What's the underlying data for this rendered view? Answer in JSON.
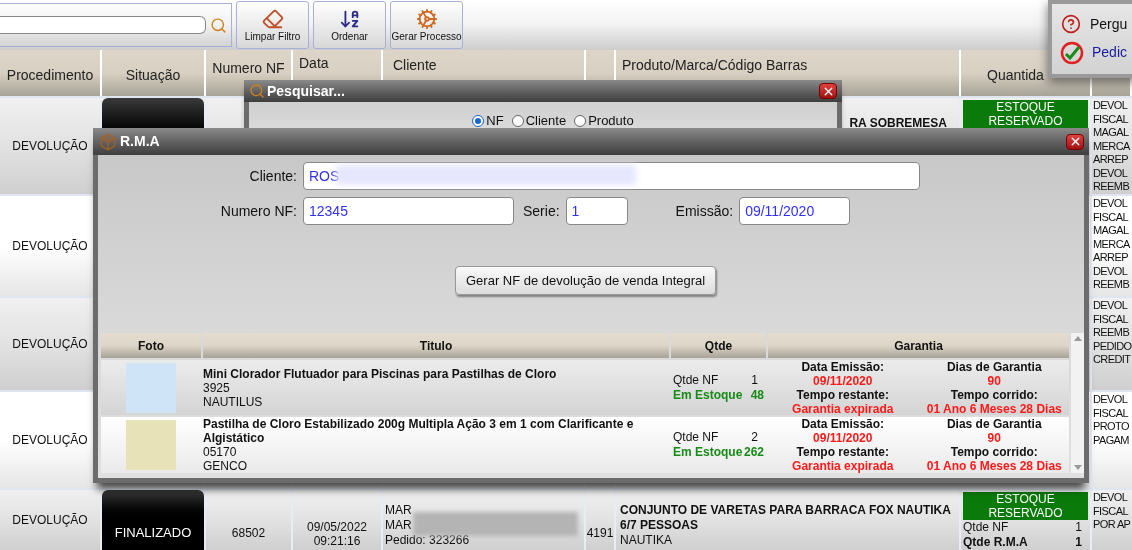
{
  "toolbar": {
    "buttons": [
      {
        "label": "Limpar Filtro",
        "kind": "eraser"
      },
      {
        "label": "Ordenar",
        "kind": "sort"
      },
      {
        "label": "Gerar Processo",
        "kind": "process"
      }
    ]
  },
  "menu": {
    "items": [
      {
        "label": "Pergu",
        "kind": "question"
      },
      {
        "label": "Pedic",
        "kind": "check"
      }
    ]
  },
  "table": {
    "columns": [
      "Procedimento",
      "Situação",
      "Numero NF",
      "Data",
      "Cliente",
      "Produto/Marca/Código Barras",
      "Quantida"
    ],
    "rows": [
      {
        "procedimento": "DEVOLUÇÃO",
        "status_block": true,
        "produto": {
          "title": "RA SOBREMESA"
        },
        "quantidade": {
          "badge": "ESTOQUE RESERVADO"
        },
        "column_9": [
          "DEVOL",
          "FISCAL",
          "MAGAL",
          "MERCA",
          "ARREP",
          "DEVOL",
          "REEMB"
        ]
      },
      {
        "procedimento": "DEVOLUÇÃO",
        "status_block": false,
        "column_9": [
          "DEVOL",
          "FISCAL",
          "MAGAL",
          "MERCA",
          "ARREP",
          "DEVOL",
          "REEMB"
        ]
      },
      {
        "procedimento": "DEVOLUÇÃO",
        "status_block": false,
        "column_9": [
          "DEVOL",
          "FISCAL",
          "REEMB",
          "PEDIDO",
          "CREDIT"
        ]
      },
      {
        "procedimento": "DEVOLUÇÃO",
        "status_block": false,
        "column_9": [
          "DEVOL",
          "FISCAL",
          "PROTO",
          "PAGAM"
        ]
      },
      {
        "procedimento": "DEVOLUÇÃO",
        "status_block": true,
        "situacao": "FINALIZADO",
        "numero_nf": "68502",
        "data": [
          "09/05/2022",
          "09:21:16"
        ],
        "cliente": [
          "MAR",
          "MAR",
          "Pedido: 323266"
        ],
        "column_6": "4191",
        "produto": {
          "title": "CONJUNTO DE VARETAS PARA BARRACA FOX NAUTIKA 6/7 PESSOAS",
          "brand": "NAUTIKA"
        },
        "quantidade": {
          "badge": "ESTOQUE RESERVADO",
          "lines": [
            {
              "label": "Qtde NF",
              "value": "1",
              "bold": false
            },
            {
              "label": "Qtde R.M.A",
              "value": "1",
              "bold": true
            }
          ]
        },
        "column_9": [
          "DEVOL",
          "FISCAL",
          "POR AP"
        ]
      }
    ]
  },
  "pesquisar": {
    "title": "Pesquisar...",
    "options": [
      {
        "label": "NF",
        "selected": true
      },
      {
        "label": "Cliente",
        "selected": false
      },
      {
        "label": "Produto",
        "selected": false
      }
    ]
  },
  "rma": {
    "title": "R.M.A",
    "cliente": {
      "label": "Cliente:",
      "value": "ROS"
    },
    "numero_nf": {
      "label": "Numero NF:",
      "value": "12345"
    },
    "serie": {
      "label": "Serie:",
      "value": "1"
    },
    "emissao": {
      "label": "Emissão:",
      "value": "09/11/2020"
    },
    "button": "Gerar NF de devolução de venda Integral",
    "columns": [
      "Foto",
      "Titulo",
      "Qtde",
      "Garantia"
    ],
    "rows": [
      {
        "title": "Mini Clorador Flutuador para Piscinas para Pastilhas de Cloro",
        "code": "3925",
        "brand": "NAUTILUS",
        "qtde_label": "Qtde NF",
        "qtde": "1",
        "stock_label": "Em Estoque",
        "stock": "48",
        "garantia": [
          [
            {
              "label": "Data Emissão:",
              "value": "09/11/2020"
            },
            {
              "label": "Tempo restante:",
              "value": "Garantia expirada"
            }
          ],
          [
            {
              "label": "Dias de Garantia",
              "value": "90"
            },
            {
              "label": "Tempo corrido:",
              "value": "01 Ano 6 Meses 28 Dias"
            }
          ]
        ]
      },
      {
        "title": "Pastilha de Cloro Estabilizado 200g Multipla Ação 3 em 1 com Clarificante e Algistático",
        "code": "05170",
        "brand": "GENCO",
        "qtde_label": "Qtde NF",
        "qtde": "2",
        "stock_label": "Em Estoque",
        "stock": "262",
        "garantia": [
          [
            {
              "label": "Data Emissão:",
              "value": "09/11/2020"
            },
            {
              "label": "Tempo restante:",
              "value": "Garantia expirada"
            }
          ],
          [
            {
              "label": "Dias de Garantia",
              "value": "90"
            },
            {
              "label": "Tempo corrido:",
              "value": "01 Ano 6 Meses 28 Dias"
            }
          ]
        ]
      }
    ]
  }
}
